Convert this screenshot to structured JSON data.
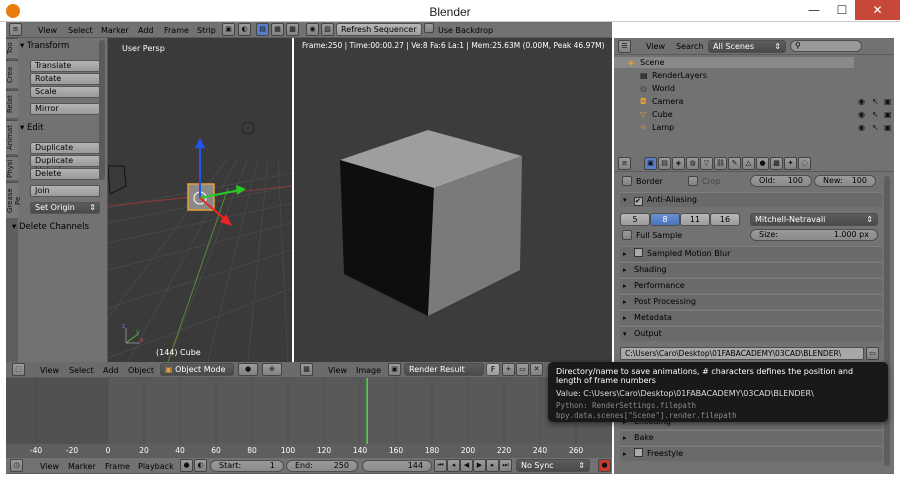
{
  "window": {
    "title": "Blender",
    "minimize": "—",
    "maximize": "☐",
    "close": "✕"
  },
  "info_header": {
    "menus": [
      "View",
      "Select",
      "Marker",
      "Add",
      "Frame",
      "Strip"
    ],
    "refresh_button": "Refresh Sequencer",
    "use_backdrop": "Use Backdrop"
  },
  "toolshelf": {
    "tabs": [
      "Too",
      "Crea",
      "Relat",
      "Animat",
      "Physi",
      "Grease Pe"
    ],
    "transform_header": "Transform",
    "transform_buttons": [
      "Translate",
      "Rotate",
      "Scale"
    ],
    "mirror": "Mirror",
    "edit_header": "Edit",
    "edit_buttons": [
      "Duplicate",
      "Duplicate Linked",
      "Delete"
    ],
    "join": "Join",
    "set_origin": "Set Origin",
    "delete_channels": "Delete Channels"
  },
  "viewport3d": {
    "label": "User Persp",
    "object_label": "(144) Cube"
  },
  "render_view": {
    "info": "Frame:250 | Time:00:00.27 | Ve:8 Fa:6 La:1 | Mem:25.63M (0.00M, Peak 46.97M)"
  },
  "outliner": {
    "menus": [
      "View",
      "Search"
    ],
    "scope": "All Scenes",
    "items": [
      {
        "label": "Scene",
        "indent": 0
      },
      {
        "label": "RenderLayers",
        "indent": 1
      },
      {
        "label": "World",
        "indent": 1
      },
      {
        "label": "Camera",
        "indent": 1
      },
      {
        "label": "Cube",
        "indent": 1
      },
      {
        "label": "Lamp",
        "indent": 1
      }
    ]
  },
  "properties": {
    "border": "Border",
    "crop": "Crop",
    "old_label": "Old:",
    "old_value": "100",
    "new_label": "New:",
    "new_value": "100",
    "anti_aliasing": "Anti-Aliasing",
    "aa_samples": [
      "5",
      "8",
      "11",
      "16"
    ],
    "aa_filter": "Mitchell-Netravali",
    "full_sample": "Full Sample",
    "size_label": "Size:",
    "size_value": "1.000 px",
    "panels": [
      "Sampled Motion Blur",
      "Shading",
      "Performance",
      "Post Processing",
      "Metadata"
    ],
    "output_header": "Output",
    "output_path": "C:\\Users\\Caro\\Desktop\\01FABACADEMY\\03CAD\\BLENDER\\",
    "lower_panels": [
      "Encoding",
      "Bake",
      "Freestyle"
    ]
  },
  "image_editor_header": {
    "menus": [
      "View",
      "Image"
    ],
    "image_name": "Render Result",
    "f_button": "F"
  },
  "view3d_header": {
    "menus": [
      "View",
      "Select",
      "Add",
      "Object"
    ],
    "mode": "Object Mode"
  },
  "timeline": {
    "ticks": [
      "-40",
      "-20",
      "0",
      "20",
      "40",
      "60",
      "80",
      "100",
      "120",
      "140",
      "160",
      "180",
      "200",
      "220",
      "240",
      "260"
    ],
    "current_frame": 144,
    "menus": [
      "View",
      "Marker",
      "Frame",
      "Playback"
    ],
    "start_label": "Start:",
    "start_value": "1",
    "end_label": "End:",
    "end_value": "250",
    "frame_value": "144",
    "sync": "No Sync"
  },
  "tooltip": {
    "line1": "Directory/name to save animations, # characters defines the position and length of frame numbers",
    "line2": "Value: C:\\Users\\Caro\\Desktop\\01FABACADEMY\\03CAD\\BLENDER\\",
    "line3": "Python: RenderSettings.filepath",
    "line4": "bpy.data.scenes[\"Scene\"].render.filepath"
  }
}
